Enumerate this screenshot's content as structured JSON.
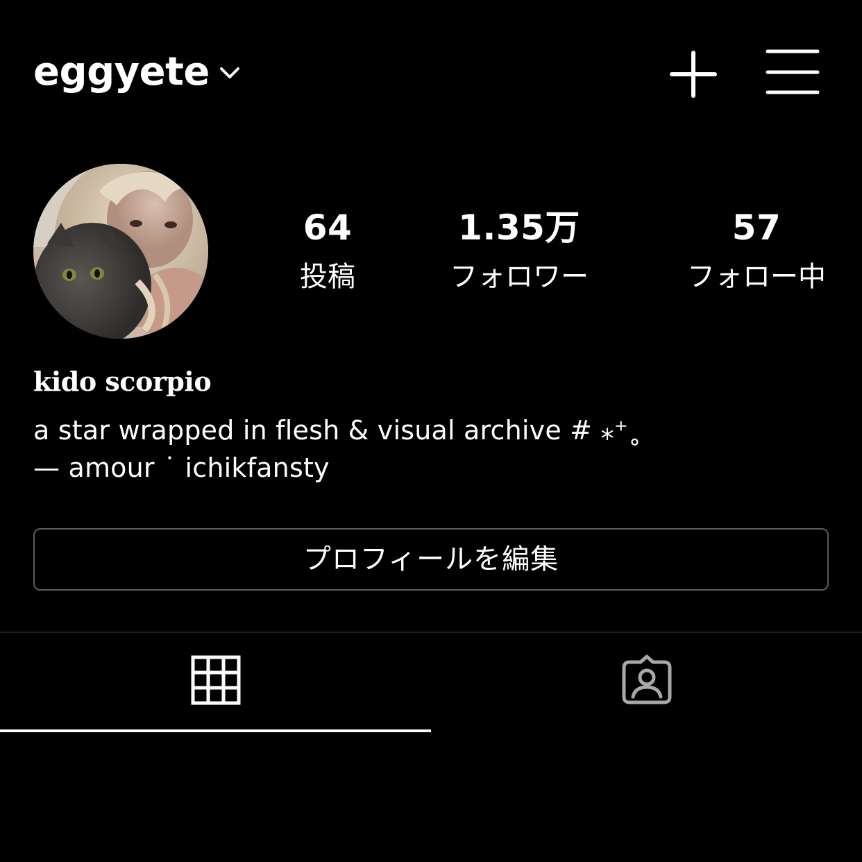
{
  "header": {
    "username": "eggyete",
    "icons": {
      "username_dropdown": "chevron-down-icon",
      "create": "plus-icon",
      "menu": "hamburger-menu-icon"
    }
  },
  "profile": {
    "avatar": "profile-photo",
    "stats": [
      {
        "value": "64",
        "label": "投稿"
      },
      {
        "value": "1.35万",
        "label": "フォロワー"
      },
      {
        "value": "57",
        "label": "フォロー中"
      }
    ],
    "display_name": "kido scorpio",
    "bio_lines": [
      "a star wrapped in flesh & visual archive # ⁎⁺˳",
      "— amour ˙ ichikfansty"
    ]
  },
  "actions": {
    "edit_profile_label": "プロフィールを編集"
  },
  "tabs": [
    {
      "icon": "grid-icon",
      "active": true
    },
    {
      "icon": "tagged-person-icon",
      "active": false
    }
  ],
  "colors": {
    "background": "#000000",
    "text": "#ffffff",
    "button_border": "#5e5e5e",
    "inactive_icon": "#a8a8a8"
  }
}
